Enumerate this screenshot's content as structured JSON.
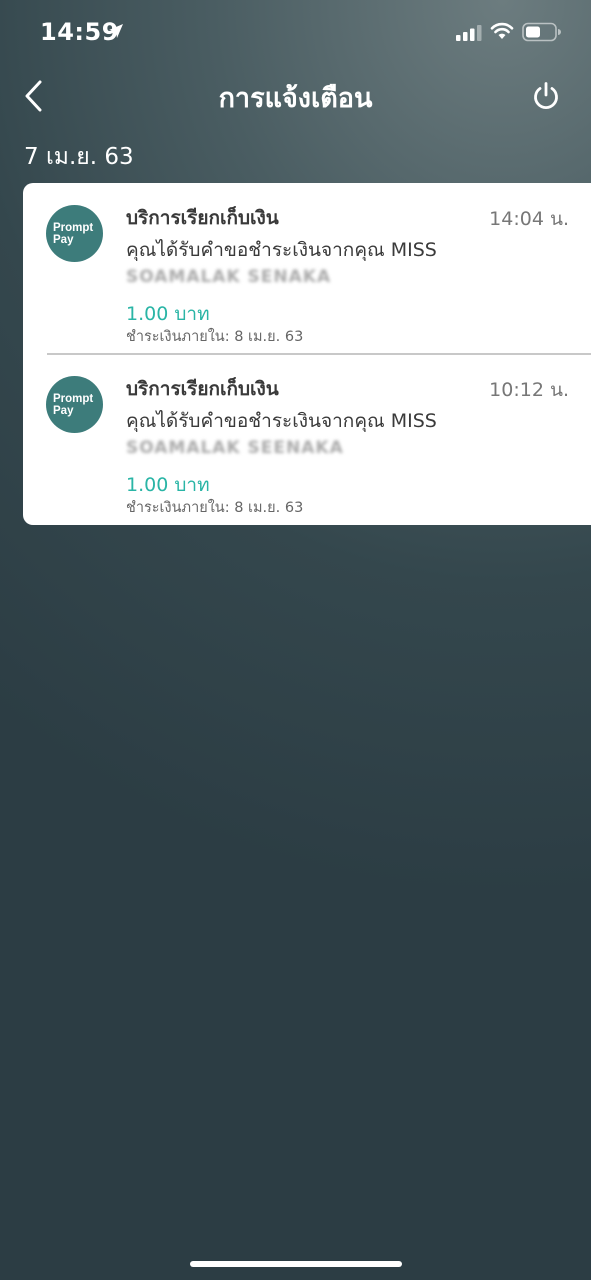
{
  "status_bar": {
    "time": "14:59"
  },
  "nav": {
    "title": "การแจ้งเตือน"
  },
  "date_header": "7 เม.ย. 63",
  "notifications": [
    {
      "avatar_line1": "Prompt",
      "avatar_line2": "Pay",
      "title": "บริการเรียกเก็บเงิน",
      "time": "14:04 น.",
      "message": "คุณได้รับคำขอชำระเงินจากคุณ MISS",
      "name": "SOAMALAK SENAKA",
      "amount": "1.00 บาท",
      "due": "ชำระเงินภายใน: 8 เม.ย. 63"
    },
    {
      "avatar_line1": "Prompt",
      "avatar_line2": "Pay",
      "title": "บริการเรียกเก็บเงิน",
      "time": "10:12 น.",
      "message": "คุณได้รับคำขอชำระเงินจากคุณ MISS",
      "name": "SOAMALAK SEENAKA",
      "amount": "1.00 บาท",
      "due": "ชำระเงินภายใน: 8 เม.ย. 63"
    }
  ],
  "colors": {
    "accent": "#2ab5a6",
    "promptpay": "#3d7c7b"
  }
}
